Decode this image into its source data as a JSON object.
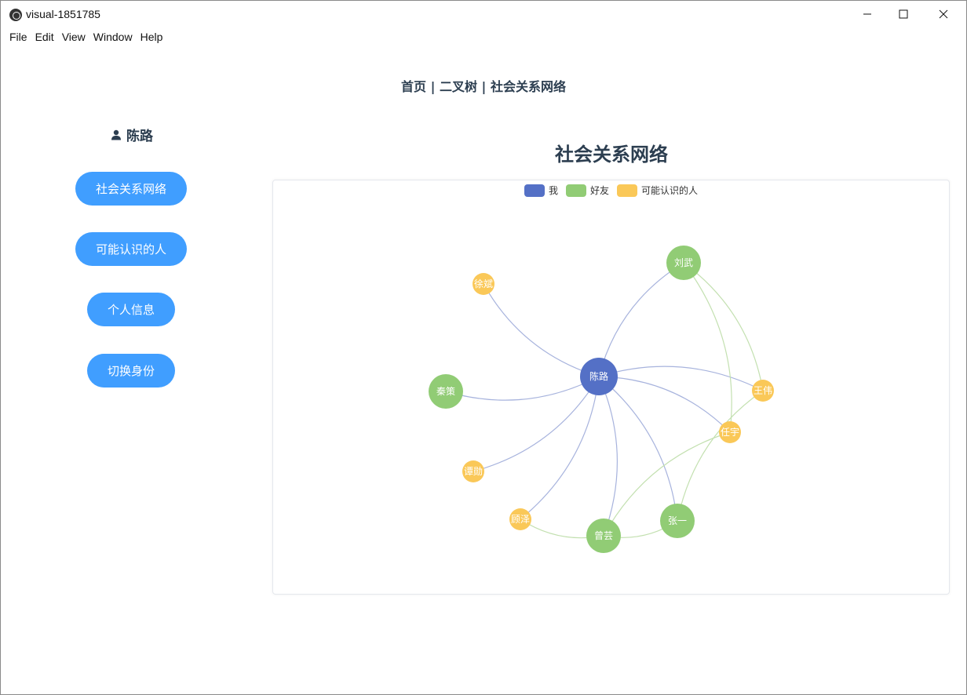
{
  "window": {
    "title": "visual-1851785",
    "controls": {
      "minimize": "minimize-icon",
      "maximize": "maximize-icon",
      "close": "close-icon"
    }
  },
  "menu": [
    "File",
    "Edit",
    "View",
    "Window",
    "Help"
  ],
  "breadcrumb": "首页 | 二叉树 | 社会关系网络",
  "user": {
    "icon": "user-icon",
    "name": "陈路"
  },
  "sidebar": [
    {
      "label": "社会关系网络"
    },
    {
      "label": "可能认识的人"
    },
    {
      "label": "个人信息"
    },
    {
      "label": "切换身份"
    }
  ],
  "chart_title": "社会关系网络",
  "colors": {
    "accent": "#409eff",
    "me": "#5470c6",
    "friend": "#91cc75",
    "maybe": "#fac858"
  },
  "chart_data": {
    "type": "graph",
    "legend": [
      {
        "name": "我",
        "category": "me"
      },
      {
        "name": "好友",
        "category": "friend"
      },
      {
        "name": "可能认识的人",
        "category": "maybe"
      }
    ],
    "nodes": [
      {
        "id": "陈路",
        "category": "me"
      },
      {
        "id": "刘武",
        "category": "friend"
      },
      {
        "id": "秦策",
        "category": "friend"
      },
      {
        "id": "曾芸",
        "category": "friend"
      },
      {
        "id": "张一",
        "category": "friend"
      },
      {
        "id": "徐斌",
        "category": "maybe"
      },
      {
        "id": "王伟",
        "category": "maybe"
      },
      {
        "id": "任宇",
        "category": "maybe"
      },
      {
        "id": "谭勋",
        "category": "maybe"
      },
      {
        "id": "顾泽",
        "category": "maybe"
      }
    ],
    "edges": [
      [
        "陈路",
        "刘武"
      ],
      [
        "陈路",
        "秦策"
      ],
      [
        "陈路",
        "曾芸"
      ],
      [
        "陈路",
        "张一"
      ],
      [
        "陈路",
        "徐斌"
      ],
      [
        "陈路",
        "王伟"
      ],
      [
        "陈路",
        "任宇"
      ],
      [
        "陈路",
        "谭勋"
      ],
      [
        "陈路",
        "顾泽"
      ],
      [
        "刘武",
        "王伟"
      ],
      [
        "刘武",
        "任宇"
      ],
      [
        "张一",
        "王伟"
      ],
      [
        "张一",
        "曾芸"
      ],
      [
        "曾芸",
        "任宇"
      ],
      [
        "曾芸",
        "顾泽"
      ]
    ]
  }
}
